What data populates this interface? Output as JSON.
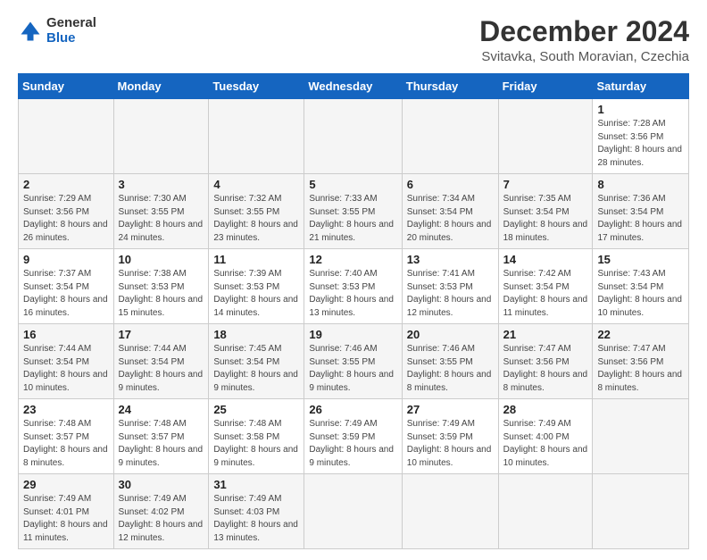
{
  "header": {
    "logo_line1": "General",
    "logo_line2": "Blue",
    "title": "December 2024",
    "subtitle": "Svitavka, South Moravian, Czechia"
  },
  "calendar": {
    "days_of_week": [
      "Sunday",
      "Monday",
      "Tuesday",
      "Wednesday",
      "Thursday",
      "Friday",
      "Saturday"
    ],
    "weeks": [
      [
        null,
        null,
        null,
        null,
        null,
        null,
        {
          "day": 1,
          "sunrise": "Sunrise: 7:28 AM",
          "sunset": "Sunset: 3:56 PM",
          "daylight": "Daylight: 8 hours and 28 minutes."
        }
      ],
      [
        {
          "day": 2,
          "sunrise": "Sunrise: 7:29 AM",
          "sunset": "Sunset: 3:56 PM",
          "daylight": "Daylight: 8 hours and 26 minutes."
        },
        {
          "day": 3,
          "sunrise": "Sunrise: 7:30 AM",
          "sunset": "Sunset: 3:55 PM",
          "daylight": "Daylight: 8 hours and 24 minutes."
        },
        {
          "day": 4,
          "sunrise": "Sunrise: 7:32 AM",
          "sunset": "Sunset: 3:55 PM",
          "daylight": "Daylight: 8 hours and 23 minutes."
        },
        {
          "day": 5,
          "sunrise": "Sunrise: 7:33 AM",
          "sunset": "Sunset: 3:55 PM",
          "daylight": "Daylight: 8 hours and 21 minutes."
        },
        {
          "day": 6,
          "sunrise": "Sunrise: 7:34 AM",
          "sunset": "Sunset: 3:54 PM",
          "daylight": "Daylight: 8 hours and 20 minutes."
        },
        {
          "day": 7,
          "sunrise": "Sunrise: 7:35 AM",
          "sunset": "Sunset: 3:54 PM",
          "daylight": "Daylight: 8 hours and 18 minutes."
        },
        {
          "day": 8,
          "sunrise": "Sunrise: 7:36 AM",
          "sunset": "Sunset: 3:54 PM",
          "daylight": "Daylight: 8 hours and 17 minutes."
        }
      ],
      [
        {
          "day": 9,
          "sunrise": "Sunrise: 7:37 AM",
          "sunset": "Sunset: 3:54 PM",
          "daylight": "Daylight: 8 hours and 16 minutes."
        },
        {
          "day": 10,
          "sunrise": "Sunrise: 7:38 AM",
          "sunset": "Sunset: 3:53 PM",
          "daylight": "Daylight: 8 hours and 15 minutes."
        },
        {
          "day": 11,
          "sunrise": "Sunrise: 7:39 AM",
          "sunset": "Sunset: 3:53 PM",
          "daylight": "Daylight: 8 hours and 14 minutes."
        },
        {
          "day": 12,
          "sunrise": "Sunrise: 7:40 AM",
          "sunset": "Sunset: 3:53 PM",
          "daylight": "Daylight: 8 hours and 13 minutes."
        },
        {
          "day": 13,
          "sunrise": "Sunrise: 7:41 AM",
          "sunset": "Sunset: 3:53 PM",
          "daylight": "Daylight: 8 hours and 12 minutes."
        },
        {
          "day": 14,
          "sunrise": "Sunrise: 7:42 AM",
          "sunset": "Sunset: 3:54 PM",
          "daylight": "Daylight: 8 hours and 11 minutes."
        },
        {
          "day": 15,
          "sunrise": "Sunrise: 7:43 AM",
          "sunset": "Sunset: 3:54 PM",
          "daylight": "Daylight: 8 hours and 10 minutes."
        }
      ],
      [
        {
          "day": 16,
          "sunrise": "Sunrise: 7:44 AM",
          "sunset": "Sunset: 3:54 PM",
          "daylight": "Daylight: 8 hours and 10 minutes."
        },
        {
          "day": 17,
          "sunrise": "Sunrise: 7:44 AM",
          "sunset": "Sunset: 3:54 PM",
          "daylight": "Daylight: 8 hours and 9 minutes."
        },
        {
          "day": 18,
          "sunrise": "Sunrise: 7:45 AM",
          "sunset": "Sunset: 3:54 PM",
          "daylight": "Daylight: 8 hours and 9 minutes."
        },
        {
          "day": 19,
          "sunrise": "Sunrise: 7:46 AM",
          "sunset": "Sunset: 3:55 PM",
          "daylight": "Daylight: 8 hours and 9 minutes."
        },
        {
          "day": 20,
          "sunrise": "Sunrise: 7:46 AM",
          "sunset": "Sunset: 3:55 PM",
          "daylight": "Daylight: 8 hours and 8 minutes."
        },
        {
          "day": 21,
          "sunrise": "Sunrise: 7:47 AM",
          "sunset": "Sunset: 3:56 PM",
          "daylight": "Daylight: 8 hours and 8 minutes."
        },
        {
          "day": 22,
          "sunrise": "Sunrise: 7:47 AM",
          "sunset": "Sunset: 3:56 PM",
          "daylight": "Daylight: 8 hours and 8 minutes."
        }
      ],
      [
        {
          "day": 23,
          "sunrise": "Sunrise: 7:48 AM",
          "sunset": "Sunset: 3:57 PM",
          "daylight": "Daylight: 8 hours and 8 minutes."
        },
        {
          "day": 24,
          "sunrise": "Sunrise: 7:48 AM",
          "sunset": "Sunset: 3:57 PM",
          "daylight": "Daylight: 8 hours and 9 minutes."
        },
        {
          "day": 25,
          "sunrise": "Sunrise: 7:48 AM",
          "sunset": "Sunset: 3:58 PM",
          "daylight": "Daylight: 8 hours and 9 minutes."
        },
        {
          "day": 26,
          "sunrise": "Sunrise: 7:49 AM",
          "sunset": "Sunset: 3:59 PM",
          "daylight": "Daylight: 8 hours and 9 minutes."
        },
        {
          "day": 27,
          "sunrise": "Sunrise: 7:49 AM",
          "sunset": "Sunset: 3:59 PM",
          "daylight": "Daylight: 8 hours and 10 minutes."
        },
        {
          "day": 28,
          "sunrise": "Sunrise: 7:49 AM",
          "sunset": "Sunset: 4:00 PM",
          "daylight": "Daylight: 8 hours and 10 minutes."
        },
        null
      ],
      [
        {
          "day": 29,
          "sunrise": "Sunrise: 7:49 AM",
          "sunset": "Sunset: 4:01 PM",
          "daylight": "Daylight: 8 hours and 11 minutes."
        },
        {
          "day": 30,
          "sunrise": "Sunrise: 7:49 AM",
          "sunset": "Sunset: 4:02 PM",
          "daylight": "Daylight: 8 hours and 12 minutes."
        },
        {
          "day": 31,
          "sunrise": "Sunrise: 7:49 AM",
          "sunset": "Sunset: 4:03 PM",
          "daylight": "Daylight: 8 hours and 13 minutes."
        },
        null,
        null,
        null,
        null
      ]
    ]
  }
}
